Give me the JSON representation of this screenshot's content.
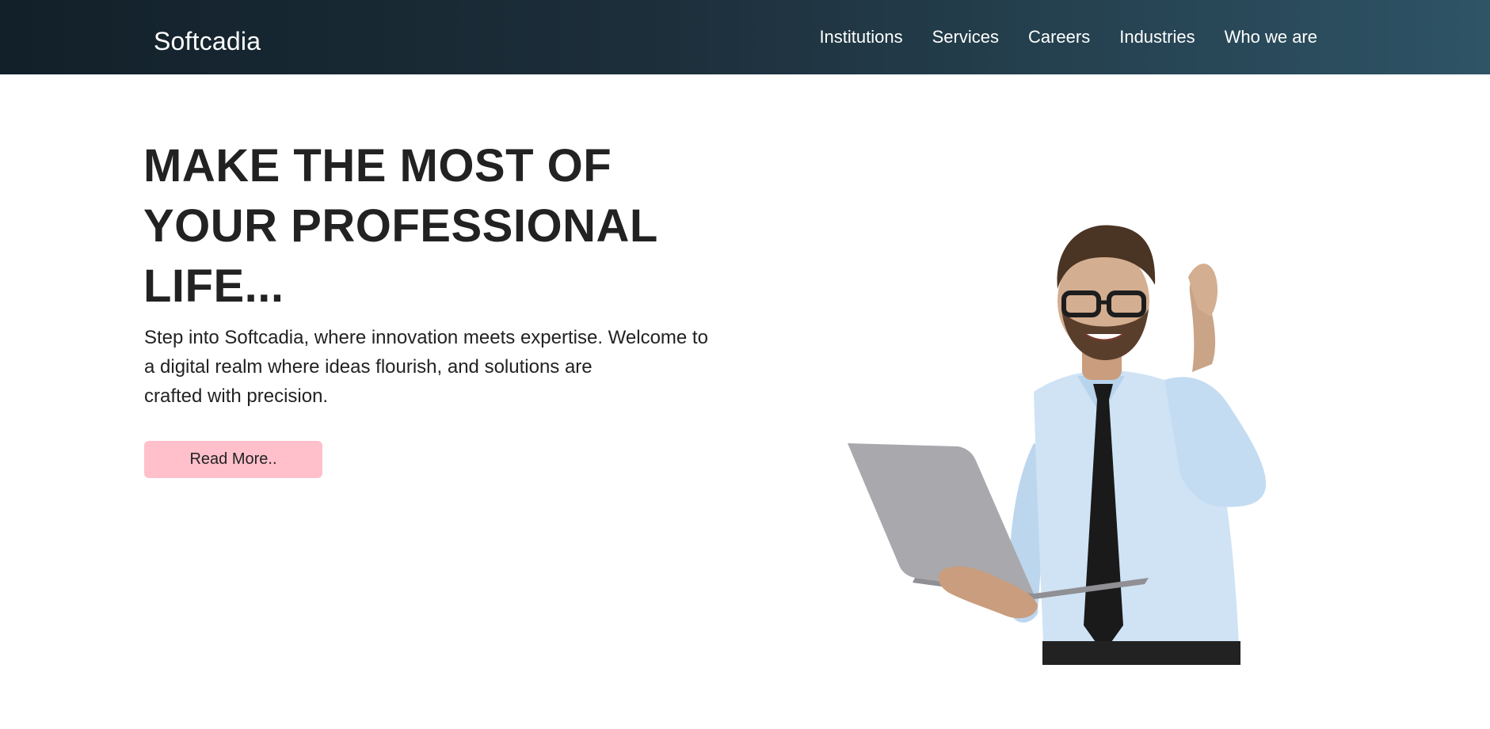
{
  "navbar": {
    "brand": "Softcadia",
    "links": [
      "Institutions",
      "Services",
      "Careers",
      "Industries",
      "Who we are"
    ]
  },
  "hero": {
    "title_lines": [
      "MAKE THE MOST OF",
      "YOUR PROFESSIONAL",
      "LIFE..."
    ],
    "text_lines": [
      "Step into Softcadia, where innovation meets expertise. Welcome to",
      "a digital realm where ideas flourish, and solutions are",
      "crafted with precision."
    ],
    "button_label": "Read More.."
  },
  "colors": {
    "navbar_start": "#122029",
    "navbar_end": "#2e5466",
    "button_bg": "#ffc0cb",
    "text": "#222222"
  }
}
